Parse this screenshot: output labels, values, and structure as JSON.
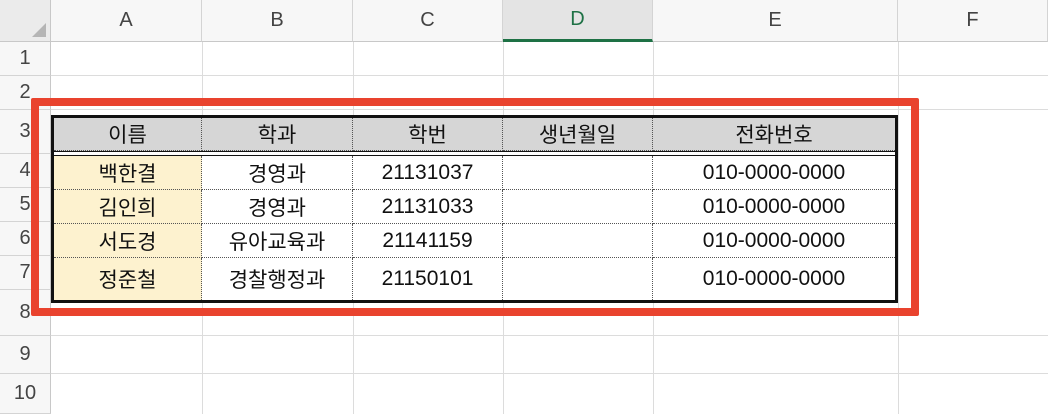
{
  "columns": [
    "A",
    "B",
    "C",
    "D",
    "E",
    "F"
  ],
  "selected_column": "D",
  "rows": [
    "1",
    "2",
    "3",
    "4",
    "5",
    "6",
    "7",
    "8",
    "9",
    "10"
  ],
  "table": {
    "headers": [
      "이름",
      "학과",
      "학번",
      "생년월일",
      "전화번호"
    ],
    "records": [
      [
        "백한결",
        "경영과",
        "21131037",
        "",
        "010-0000-0000"
      ],
      [
        "김인희",
        "경영과",
        "21131033",
        "",
        "010-0000-0000"
      ],
      [
        "서도경",
        "유아교육과",
        "21141159",
        "",
        "010-0000-0000"
      ],
      [
        "정준철",
        "경찰행정과",
        "21150101",
        "",
        "010-0000-0000"
      ]
    ]
  },
  "colors": {
    "highlight": "#e9432e",
    "header_fill": "#d6d6d6",
    "name_fill": "#fdf2cf",
    "selected_header": "#1e7145"
  }
}
